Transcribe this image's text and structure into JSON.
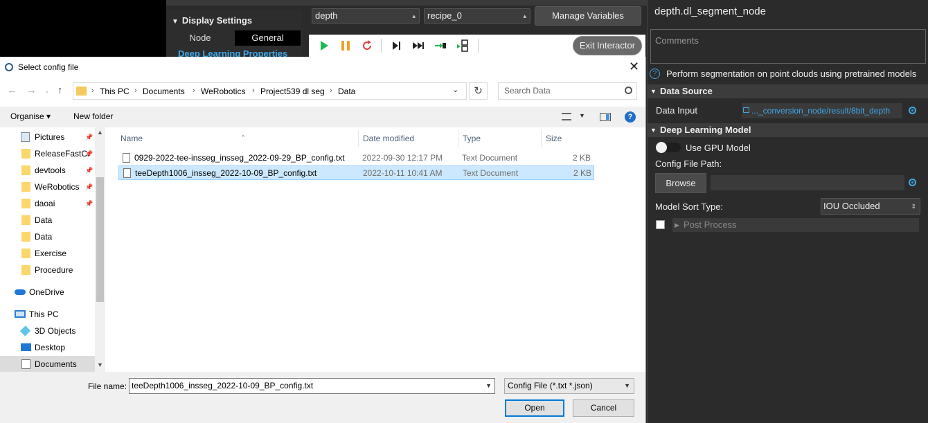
{
  "app": {
    "display_settings": {
      "title": "Display Settings",
      "tab_node": "Node",
      "tab_general": "General",
      "deep_learning_properties": "Deep Learning Properties"
    },
    "selectors": {
      "depth": "depth",
      "recipe": "recipe_0"
    },
    "manage_variables": "Manage Variables",
    "exit_interactor": "Exit Interactor",
    "toolbar_icons": [
      "play-icon",
      "pause-icon",
      "restart-icon",
      "step-icon",
      "fast-forward-icon",
      "step-into-icon",
      "step-over-icon"
    ]
  },
  "right_panel": {
    "node_title": "depth.dl_segment_node",
    "comments_placeholder": "Comments",
    "description": "Perform segmentation on point clouds using pretrained models",
    "data_source": {
      "header": "Data Source",
      "data_input_label": "Data Input",
      "data_input_value": "..._conversion_node/result/8bit_depth"
    },
    "deep_learning_model": {
      "header": "Deep Learning Model",
      "use_gpu_label": "Use GPU Model",
      "use_gpu_enabled": false,
      "config_file_path_label": "Config File Path:",
      "browse_label": "Browse",
      "config_file_path_value": "",
      "model_sort_type_label": "Model Sort Type:",
      "model_sort_type_value": "IOU Occluded",
      "post_process_label": "Post Process",
      "post_process_checked": false
    },
    "accent_color": "#3fa7e8"
  },
  "dialog": {
    "title": "Select config file",
    "breadcrumb": [
      "This PC",
      "Documents",
      "WeRobotics",
      "Project539 dl seg",
      "Data"
    ],
    "search_placeholder": "Search Data",
    "organise_label": "Organise ▾",
    "new_folder_label": "New folder",
    "nav_items": [
      {
        "label": "Pictures",
        "icon": "pictures-icon",
        "pinned": true
      },
      {
        "label": "ReleaseFastCr",
        "icon": "folder-icon",
        "pinned": true
      },
      {
        "label": "devtools",
        "icon": "folder-icon",
        "pinned": true
      },
      {
        "label": "WeRobotics",
        "icon": "folder-icon",
        "pinned": true
      },
      {
        "label": "daoai",
        "icon": "folder-icon",
        "pinned": true
      },
      {
        "label": "Data",
        "icon": "folder-icon",
        "pinned": false
      },
      {
        "label": "Data",
        "icon": "folder-icon",
        "pinned": false
      },
      {
        "label": "Exercise",
        "icon": "folder-icon",
        "pinned": false
      },
      {
        "label": "Procedure",
        "icon": "folder-icon",
        "pinned": false
      },
      {
        "label": "OneDrive",
        "icon": "onedrive-icon",
        "pinned": false
      },
      {
        "label": "This PC",
        "icon": "computer-icon",
        "pinned": false
      },
      {
        "label": "3D Objects",
        "icon": "3d-objects-icon",
        "pinned": false
      },
      {
        "label": "Desktop",
        "icon": "desktop-icon",
        "pinned": false
      },
      {
        "label": "Documents",
        "icon": "documents-icon",
        "pinned": false,
        "selected": true
      }
    ],
    "columns": {
      "name": "Name",
      "date": "Date modified",
      "type": "Type",
      "size": "Size"
    },
    "files": [
      {
        "name": "0929-2022-tee-insseg_insseg_2022-09-29_BP_config.txt",
        "date": "2022-09-30 12:17 PM",
        "type": "Text Document",
        "size": "2 KB",
        "selected": false
      },
      {
        "name": "teeDepth1006_insseg_2022-10-09_BP_config.txt",
        "date": "2022-10-11 10:41 AM",
        "type": "Text Document",
        "size": "2 KB",
        "selected": true
      }
    ],
    "file_name_label": "File name:",
    "file_name_value": "teeDepth1006_insseg_2022-10-09_BP_config.txt",
    "file_type_value": "Config File (*.txt *.json)",
    "open_label": "Open",
    "cancel_label": "Cancel"
  }
}
